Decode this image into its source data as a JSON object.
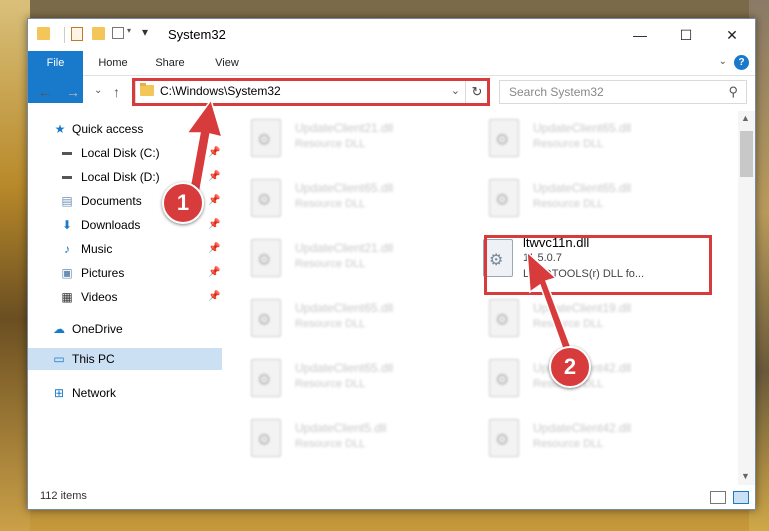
{
  "window": {
    "title": "System32"
  },
  "title_controls": {
    "minimize": "—",
    "maximize": "☐",
    "close": "✕"
  },
  "ribbon": {
    "tabs": [
      "File",
      "Home",
      "Share",
      "View"
    ],
    "help": "?"
  },
  "address": {
    "path": "C:\\Windows\\System32"
  },
  "search": {
    "placeholder": "Search System32"
  },
  "sidebar": {
    "items": [
      {
        "label": "Quick access",
        "icon": "star-icon"
      },
      {
        "label": "Local Disk (C:)",
        "icon": "drive-icon"
      },
      {
        "label": "Local Disk (D:)",
        "icon": "drive-icon"
      },
      {
        "label": "Documents",
        "icon": "documents-icon"
      },
      {
        "label": "Downloads",
        "icon": "download-icon"
      },
      {
        "label": "Music",
        "icon": "music-icon"
      },
      {
        "label": "Pictures",
        "icon": "pictures-icon"
      },
      {
        "label": "Videos",
        "icon": "videos-icon"
      },
      {
        "label": "OneDrive",
        "icon": "cloud-icon"
      },
      {
        "label": "This PC",
        "icon": "computer-icon"
      },
      {
        "label": "Network",
        "icon": "network-icon"
      }
    ]
  },
  "files": [
    {
      "name": "UpdateClient21.dll",
      "desc": "Resource DLL"
    },
    {
      "name": "UpdateClient65.dll",
      "desc": "Resource DLL"
    },
    {
      "name": "UpdateClient65.dll",
      "desc": "Resource DLL"
    },
    {
      "name": "UpdateClient65.dll",
      "desc": "Resource DLL"
    },
    {
      "name": "UpdateClient21.dll",
      "desc": "Resource DLL"
    },
    {
      "name": "ltwvc11n.dll",
      "version": "11.5.0.7",
      "desc": "LEADTOOLS(r) DLL fo..."
    },
    {
      "name": "UpdateClient65.dll",
      "desc": "Resource DLL"
    },
    {
      "name": "UpdateClient19.dll",
      "desc": "Resource DLL"
    },
    {
      "name": "UpdateClient65.dll",
      "desc": "Resource DLL"
    },
    {
      "name": "UpdateClient42.dll",
      "desc": "Resource DLL"
    },
    {
      "name": "UpdateClient5.dll",
      "desc": "Resource DLL"
    },
    {
      "name": "UpdateClient42.dll",
      "desc": "Resource DLL"
    }
  ],
  "status": {
    "count": "112 items"
  },
  "callouts": {
    "one": "1",
    "two": "2"
  },
  "colors": {
    "accent": "#1979ca",
    "highlight": "#d83b3b",
    "selected": "#cce0f4"
  }
}
